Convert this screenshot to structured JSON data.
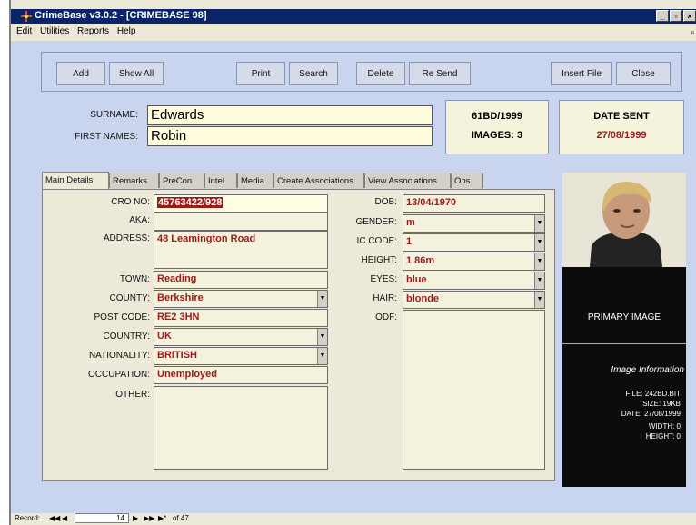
{
  "window": {
    "title": "CrimeBase v3.0.2 - [CRIMEBASE 98]",
    "controls": [
      "_",
      "▫",
      "×"
    ]
  },
  "menu": {
    "items": [
      "Edit",
      "Utilities",
      "Reports",
      "Help"
    ],
    "mdi_controls": "▫"
  },
  "toolbar": {
    "add": "Add",
    "show_all": "Show All",
    "print": "Print",
    "search": "Search",
    "delete": "Delete",
    "resend": "Re Send",
    "insert_file": "Insert File",
    "close": "Close"
  },
  "header": {
    "surname_label": "SURNAME:",
    "surname": "Edwards",
    "first_names_label": "FIRST NAMES:",
    "first_names": "Robin",
    "record_id": "61BD/1999",
    "images": "IMAGES: 3",
    "date_sent_label": "DATE SENT",
    "date_sent": "27/08/1999"
  },
  "tabs": [
    "Main Details",
    "Remarks",
    "PreCon",
    "Intel",
    "Media",
    "Create Associations",
    "View Associations",
    "Ops"
  ],
  "left_fields": {
    "cro_no_label": "CRO NO:",
    "cro_no": "45763422/928",
    "aka_label": "AKA:",
    "aka": "",
    "address_label": "ADDRESS:",
    "address": "48 Leamington Road",
    "town_label": "TOWN:",
    "town": "Reading",
    "county_label": "COUNTY:",
    "county": "Berkshire",
    "postcode_label": "POST CODE:",
    "postcode": "RE2 3HN",
    "country_label": "COUNTRY:",
    "country": "UK",
    "nationality_label": "NATIONALITY:",
    "nationality": "BRITISH",
    "occupation_label": "OCCUPATION:",
    "occupation": "Unemployed",
    "other_label": "OTHER:"
  },
  "right_fields": {
    "dob_label": "DOB:",
    "dob": "13/04/1970",
    "gender_label": "GENDER:",
    "gender": "m",
    "ic_code_label": "IC CODE:",
    "ic_code": "1",
    "height_label": "HEIGHT:",
    "height": "1.86m",
    "eyes_label": "EYES:",
    "eyes": "blue",
    "hair_label": "HAIR:",
    "hair": "blonde",
    "odf_label": "ODF:"
  },
  "image_panel": {
    "primary": "PRIMARY IMAGE",
    "info_title": "Image Information",
    "file": "FILE: 242BD.BIT",
    "size": "SIZE: 19KB",
    "date": "DATE: 27/08/1999",
    "width": "WIDTH: 0",
    "height": "HEIGHT: 0"
  },
  "statusbar": {
    "record_label": "Record:",
    "record_num": "14",
    "of_total": "of 47"
  },
  "colors": {
    "title_bar": "#0a246a",
    "client_bg": "#c9d5ee",
    "value_text": "#9b1a1a"
  }
}
